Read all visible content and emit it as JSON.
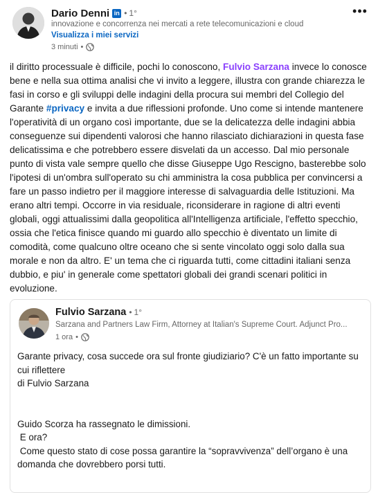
{
  "post": {
    "author": {
      "name": "Dario Denni",
      "badge": "in",
      "degree": "1°",
      "headline": "innovazione e concorrenza nei mercati a rete telecomunicazioni e cloud",
      "services_link": "Visualizza i miei servizi",
      "time": "3 minuti"
    },
    "menu_icon": "more-horizontal-icon",
    "body": {
      "part1": "il diritto processuale è difficile, pochi lo conoscono, ",
      "mention": "Fulvio Sarzana",
      "part2": " invece lo conosce bene e nella sua ottima analisi che vi invito a leggere, illustra con grande chiarezza le fasi in corso e gli sviluppi delle indagini della procura sui membri del Collegio del Garante ",
      "hashtag": "#privacy",
      "part3": " e invita a due riflessioni profonde. Uno come si intende mantenere l'operatività di un organo così importante, due se la delicatezza delle indagini abbia conseguenze sui dipendenti valorosi che hanno rilasciato dichiarazioni in questa fase delicatissima e che potrebbero essere disvelati da un accesso. Dal mio personale punto di vista vale sempre quello che disse Giuseppe Ugo Rescigno, basterebbe solo l'ipotesi di un'ombra sull'operato su chi amministra la cosa pubblica per convincersi a fare un passo indietro per il maggiore interesse di salvaguardia delle Istituzioni. Ma erano altri tempi. Occorre in via residuale, riconsiderare in ragione di altri eventi globali, oggi attualissimi dalla geopolitica all'Intelligenza artificiale, l'effetto specchio, ossia che l'etica finisce quando mi guardo allo specchio è diventato un limite di comodità, come qualcuno oltre oceano che si sente vincolato oggi solo dalla sua morale e non da altro. E' un tema che ci riguarda tutti, come cittadini italiani senza dubbio, e piu' in generale come spettatori globali dei grandi scenari politici in evoluzione."
    },
    "reshared": {
      "author": {
        "name": "Fulvio Sarzana",
        "degree": "1°",
        "headline": "Sarzana and Partners Law Firm, Attorney at Italian's Supreme Court. Adjunct Pro...",
        "time": "1 ora"
      },
      "lines": [
        "Garante privacy, cosa succede ora sul fronte giudiziario? C'è un fatto importante su cui riflettere",
        "di Fulvio Sarzana",
        "",
        "",
        "Guido Scorza ha rassegnato le dimissioni.",
        " E ora?",
        " Come questo stato di cose possa garantire la “sopravvivenza” dell’organo è una domanda che dovrebbero porsi tutti."
      ]
    }
  }
}
